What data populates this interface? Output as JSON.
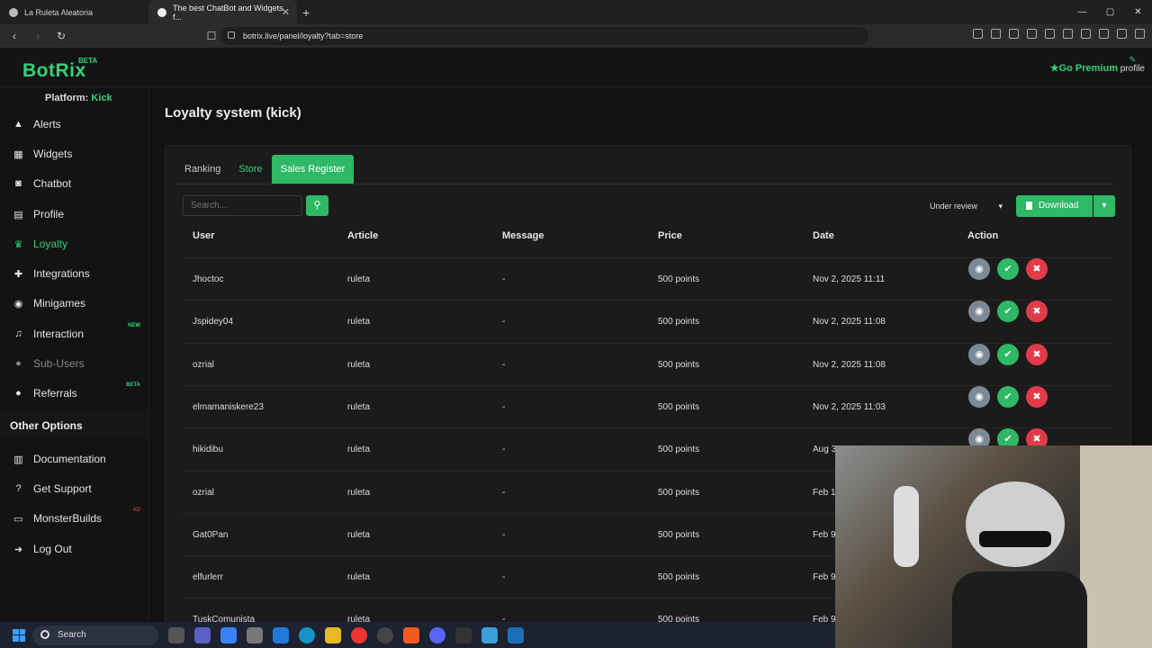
{
  "browser": {
    "tabs": [
      {
        "title": "La Ruleta Aleatoria"
      },
      {
        "title": "The best ChatBot and Widgets f..."
      }
    ],
    "new_tab": "+",
    "url": "botrix.live/panel/loyalty?tab=store",
    "window_controls": {
      "minimize": "—",
      "maximize": "▢",
      "close": "✕"
    }
  },
  "header": {
    "logo": "BotRix",
    "beta": "BETA",
    "premium": "Go Premium",
    "profile": "profile"
  },
  "sidebar": {
    "platform_label": "Platform:",
    "platform_value": "Kick",
    "items": [
      {
        "label": "Alerts",
        "icon": "warning-icon"
      },
      {
        "label": "Widgets",
        "icon": "grid-icon"
      },
      {
        "label": "Chatbot",
        "icon": "robot-icon"
      },
      {
        "label": "Profile",
        "icon": "id-card-icon"
      },
      {
        "label": "Loyalty",
        "icon": "trophy-icon"
      },
      {
        "label": "Integrations",
        "icon": "puzzle-icon"
      },
      {
        "label": "Minigames",
        "icon": "gamepad-icon"
      },
      {
        "label": "Interaction",
        "icon": "music-icon",
        "tag": "NEW"
      },
      {
        "label": "Sub-Users",
        "icon": "users-icon"
      },
      {
        "label": "Referrals",
        "icon": "users-icon",
        "tag": "BETA"
      }
    ],
    "other_title": "Other Options",
    "other_items": [
      {
        "label": "Documentation",
        "icon": "book-icon"
      },
      {
        "label": "Get Support",
        "icon": "help-icon"
      },
      {
        "label": "MonsterBuilds",
        "icon": "laptop-icon",
        "tag": "AD"
      },
      {
        "label": "Log Out",
        "icon": "logout-icon"
      }
    ]
  },
  "main": {
    "title": "Loyalty system (kick)",
    "tabs": [
      "Ranking",
      "Store",
      "Sales Register"
    ],
    "search_placeholder": "Search...",
    "filter": "Under review",
    "download": "Download",
    "columns": [
      "User",
      "Article",
      "Message",
      "Price",
      "Date",
      "Action"
    ],
    "rows": [
      {
        "user": "Jhoctoc",
        "article": "ruleta",
        "message": "-",
        "price": "500 points",
        "date": "Nov 2, 2025 11:11"
      },
      {
        "user": "Jspidey04",
        "article": "ruleta",
        "message": "-",
        "price": "500 points",
        "date": "Nov 2, 2025 11:08"
      },
      {
        "user": "ozrial",
        "article": "ruleta",
        "message": "-",
        "price": "500 points",
        "date": "Nov 2, 2025 11:08"
      },
      {
        "user": "elmamaniskere23",
        "article": "ruleta",
        "message": "-",
        "price": "500 points",
        "date": "Nov 2, 2025 11:03"
      },
      {
        "user": "hikidibu",
        "article": "ruleta",
        "message": "-",
        "price": "500 points",
        "date": "Aug 31, 2025 10:09"
      },
      {
        "user": "ozrial",
        "article": "ruleta",
        "message": "-",
        "price": "500 points",
        "date": "Feb 1"
      },
      {
        "user": "Gat0Pan",
        "article": "ruleta",
        "message": "-",
        "price": "500 points",
        "date": "Feb 9"
      },
      {
        "user": "elfurlerr",
        "article": "ruleta",
        "message": "-",
        "price": "500 points",
        "date": "Feb 9"
      },
      {
        "user": "TuskComunista",
        "article": "ruleta",
        "message": "-",
        "price": "500 points",
        "date": "Feb 9"
      }
    ]
  },
  "taskbar": {
    "search": "Search"
  },
  "colors": {
    "accent": "#2fb865",
    "danger": "#e23b48",
    "view": "#7b8a96"
  }
}
